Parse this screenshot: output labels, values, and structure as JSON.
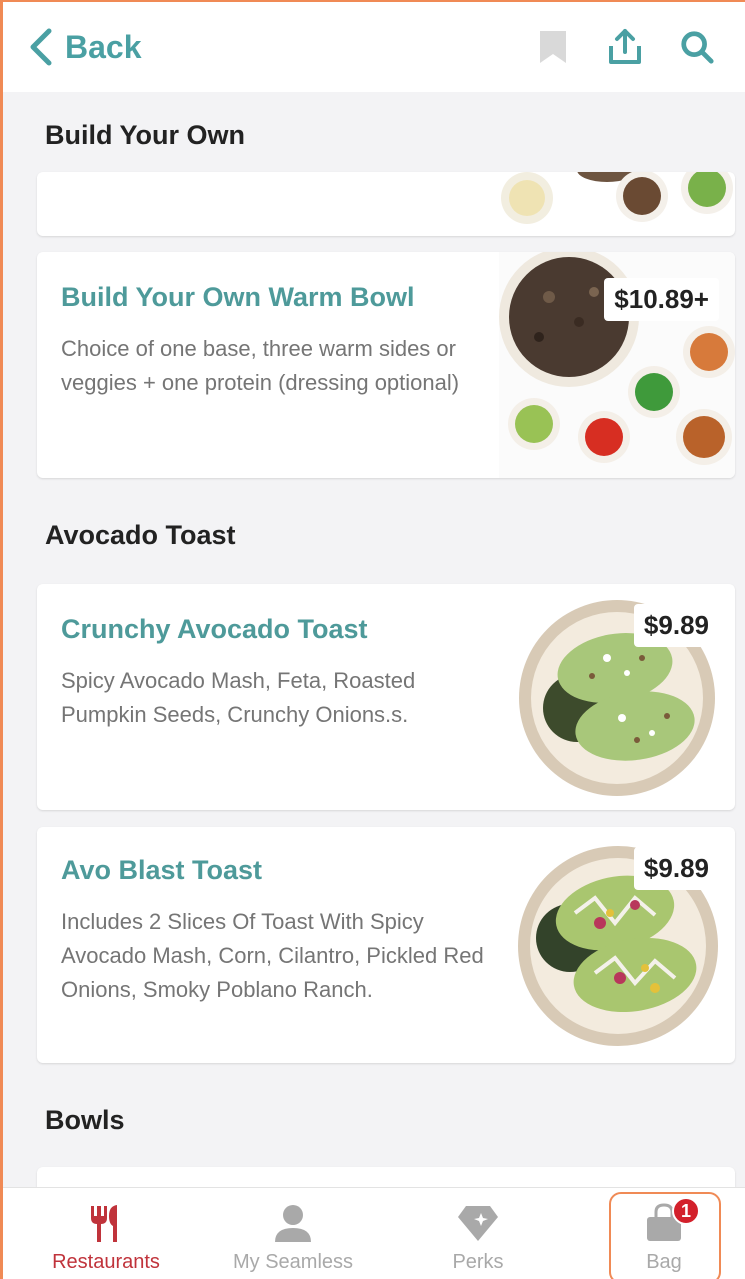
{
  "header": {
    "back_label": "Back",
    "icons": [
      "chevron-left-icon",
      "bookmark-icon",
      "share-icon",
      "search-icon"
    ]
  },
  "sections": [
    {
      "title": "Build Your Own",
      "items": [
        {
          "name": "Build Your Own Warm Bowl",
          "description": "Choice of one base, three warm sides or veggies + one protein (dressing optional)",
          "price": "$10.89+"
        }
      ]
    },
    {
      "title": "Avocado Toast",
      "items": [
        {
          "name": "Crunchy Avocado Toast",
          "description": "Spicy Avocado Mash, Feta, Roasted Pumpkin Seeds, Crunchy Onions.s.",
          "price": "$9.89"
        },
        {
          "name": "Avo Blast Toast",
          "description": "Includes 2 Slices Of Toast With Spicy Avocado Mash, Corn, Cilantro, Pickled Red Onions, Smoky Poblano Ranch.",
          "price": "$9.89"
        }
      ]
    },
    {
      "title": "Bowls",
      "items": []
    }
  ],
  "bottom_nav": {
    "items": [
      {
        "label": "Restaurants",
        "icon": "fork-knife-icon",
        "active": true
      },
      {
        "label": "My Seamless",
        "icon": "person-icon",
        "active": false
      },
      {
        "label": "Perks",
        "icon": "diamond-icon",
        "active": false
      },
      {
        "label": "Bag",
        "icon": "bag-icon",
        "active": false,
        "badge": "1"
      }
    ]
  },
  "colors": {
    "accent_teal": "#4aa0a3",
    "active_red": "#c0333b",
    "badge_red": "#d3202b",
    "highlight_orange": "#f08a55"
  }
}
